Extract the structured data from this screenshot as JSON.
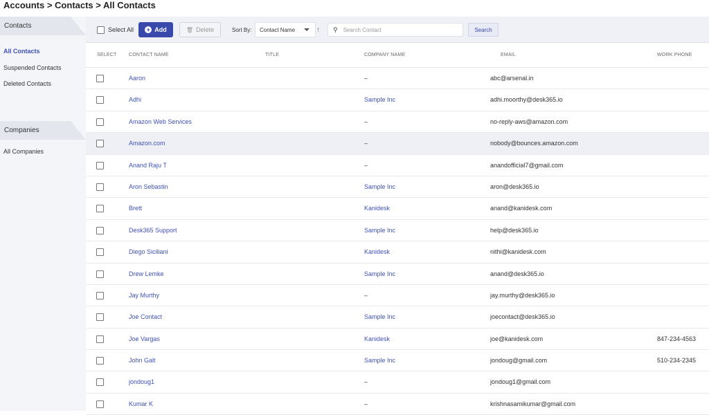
{
  "breadcrumb": "Accounts > Contacts > All Contacts",
  "sidebar": {
    "contacts_header": "Contacts",
    "contacts_items": [
      {
        "label": "All Contacts"
      },
      {
        "label": "Suspended Contacts"
      },
      {
        "label": "Deleted Contacts"
      }
    ],
    "companies_header": "Companies",
    "companies_items": [
      {
        "label": "All Companies"
      }
    ]
  },
  "toolbar": {
    "select_all_label": "Select All",
    "add_label": "Add",
    "delete_label": "Delete",
    "sort_by_label": "Sort By:",
    "sort_value": "Contact Name",
    "search_placeholder": "Search Contact",
    "search_label": "Search"
  },
  "columns": {
    "select": "SELECT",
    "name": "CONTACT NAME",
    "title": "TITLE",
    "company": "COMPANY NAME",
    "email": "EMAIL",
    "phone": "WORK PHONE"
  },
  "rows": [
    {
      "name": "Aaron",
      "company": "–",
      "email": "abc@arsenal.in",
      "phone": ""
    },
    {
      "name": "Adhi",
      "company": "Sample Inc",
      "email": "adhi.moorthy@desk365.io",
      "phone": ""
    },
    {
      "name": "Amazon Web Services",
      "company": "–",
      "email": "no-reply-aws@amazon.com",
      "phone": ""
    },
    {
      "name": "Amazon.com",
      "company": "–",
      "email": "nobody@bounces.amazon.com",
      "phone": ""
    },
    {
      "name": "Anand Raju T",
      "company": "–",
      "email": "anandofficial7@gmail.com",
      "phone": ""
    },
    {
      "name": "Aron Sebastin",
      "company": "Sample Inc",
      "email": "aron@desk365.io",
      "phone": ""
    },
    {
      "name": "Brett",
      "company": "Kanidesk",
      "email": "anand@kanidesk.com",
      "phone": ""
    },
    {
      "name": "Desk365 Support",
      "company": "Sample Inc",
      "email": "help@desk365.io",
      "phone": ""
    },
    {
      "name": "Diego Siciliani",
      "company": "Kanidesk",
      "email": "nithi@kanidesk.com",
      "phone": ""
    },
    {
      "name": "Drew Lemke",
      "company": "Sample Inc",
      "email": "anand@desk365.io",
      "phone": ""
    },
    {
      "name": "Jay Murthy",
      "company": "–",
      "email": "jay.murthy@desk365.io",
      "phone": ""
    },
    {
      "name": "Joe Contact",
      "company": "Sample Inc",
      "email": "joecontact@desk365.io",
      "phone": ""
    },
    {
      "name": "Joe Vargas",
      "company": "Kanidesk",
      "email": "joe@kanidesk.com",
      "phone": "847-234-4563"
    },
    {
      "name": "John Galt",
      "company": "Sample Inc",
      "email": "jondoug@gmail.com",
      "phone": "510-234-2345"
    },
    {
      "name": "jondoug1",
      "company": "–",
      "email": "jondoug1@gmail.com",
      "phone": ""
    },
    {
      "name": "Kumar K",
      "company": "–",
      "email": "krishnasamikumar@gmail.com",
      "phone": ""
    }
  ]
}
